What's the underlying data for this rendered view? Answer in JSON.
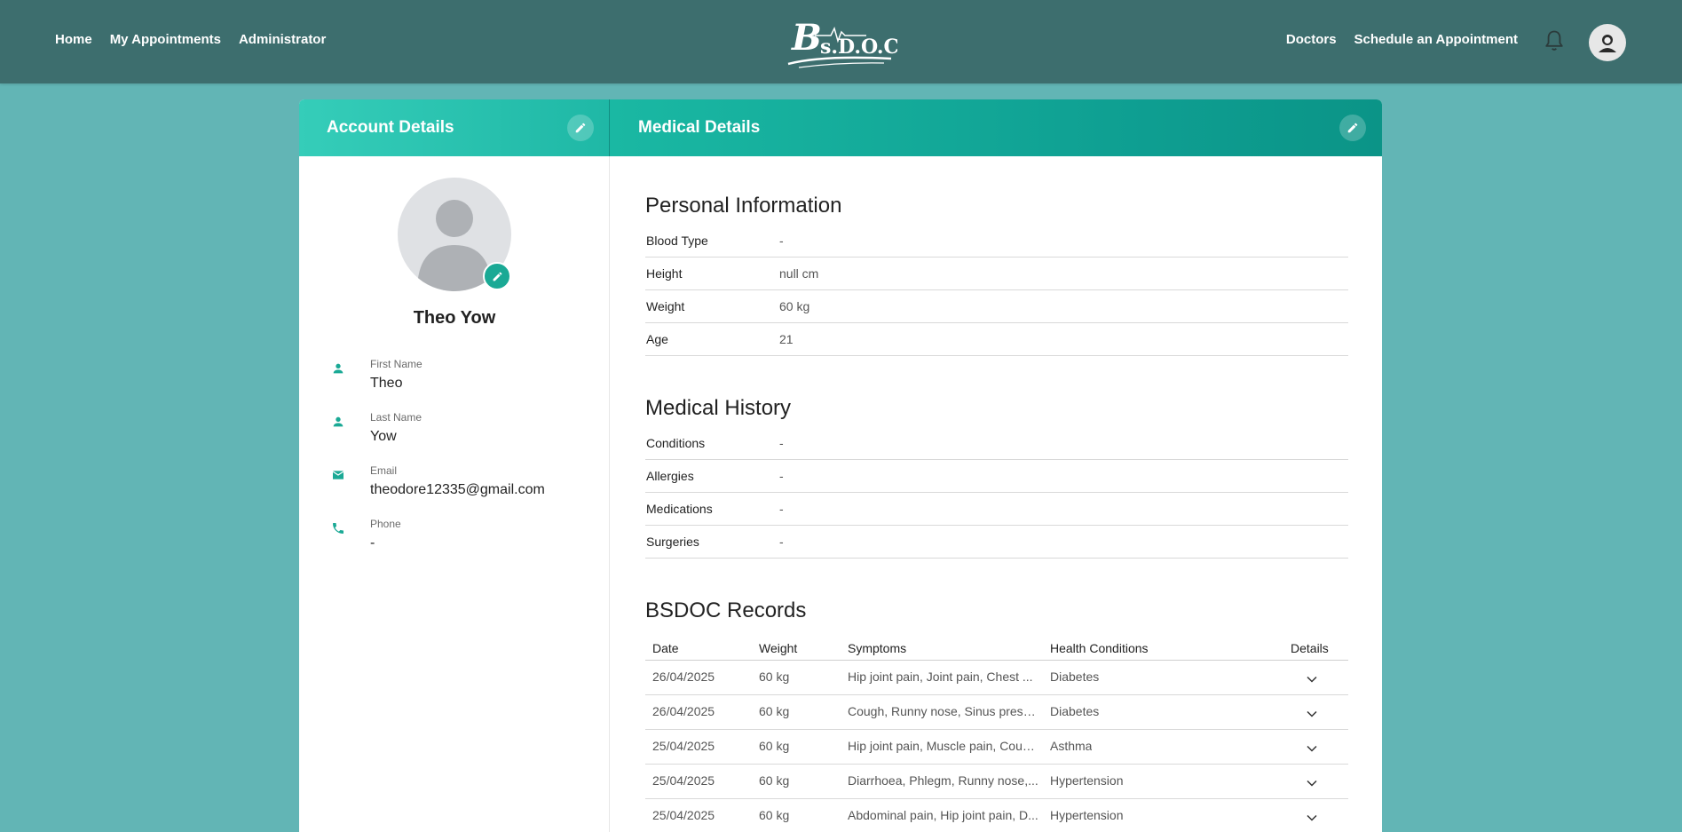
{
  "nav": {
    "left": [
      "Home",
      "My Appointments",
      "Administrator"
    ],
    "right": [
      "Doctors",
      "Schedule an Appointment"
    ],
    "logo_text": "Bs.D.O.C"
  },
  "account": {
    "header": "Account Details",
    "name": "Theo Yow",
    "fields": [
      {
        "label": "First Name",
        "value": "Theo",
        "icon": "person-icon"
      },
      {
        "label": "Last Name",
        "value": "Yow",
        "icon": "person-icon"
      },
      {
        "label": "Email",
        "value": "theodore12335@gmail.com",
        "icon": "email-icon"
      },
      {
        "label": "Phone",
        "value": "-",
        "icon": "phone-icon"
      }
    ]
  },
  "medical": {
    "header": "Medical Details",
    "personal_title": "Personal Information",
    "personal": [
      {
        "label": "Blood Type",
        "value": "-"
      },
      {
        "label": "Height",
        "value": "null cm"
      },
      {
        "label": "Weight",
        "value": "60 kg"
      },
      {
        "label": "Age",
        "value": "21"
      }
    ],
    "history_title": "Medical History",
    "history": [
      {
        "label": "Conditions",
        "value": "-"
      },
      {
        "label": "Allergies",
        "value": "-"
      },
      {
        "label": "Medications",
        "value": "-"
      },
      {
        "label": "Surgeries",
        "value": "-"
      }
    ],
    "records_title": "BSDOC Records",
    "records_columns": [
      "Date",
      "Weight",
      "Symptoms",
      "Health Conditions",
      "Details"
    ],
    "records": [
      {
        "date": "26/04/2025",
        "weight": "60 kg",
        "symptoms": "Hip joint pain, Joint pain, Chest ...",
        "conditions": "Diabetes"
      },
      {
        "date": "26/04/2025",
        "weight": "60 kg",
        "symptoms": "Cough, Runny nose, Sinus press...",
        "conditions": "Diabetes"
      },
      {
        "date": "25/04/2025",
        "weight": "60 kg",
        "symptoms": "Hip joint pain, Muscle pain, Coug...",
        "conditions": "Asthma"
      },
      {
        "date": "25/04/2025",
        "weight": "60 kg",
        "symptoms": "Diarrhoea, Phlegm, Runny nose,...",
        "conditions": "Hypertension"
      },
      {
        "date": "25/04/2025",
        "weight": "60 kg",
        "symptoms": "Abdominal pain, Hip joint pain, D...",
        "conditions": "Hypertension"
      }
    ]
  },
  "colors": {
    "topbar": "#3d6e6e",
    "background": "#62b5b5",
    "accent": "#1aa995"
  }
}
